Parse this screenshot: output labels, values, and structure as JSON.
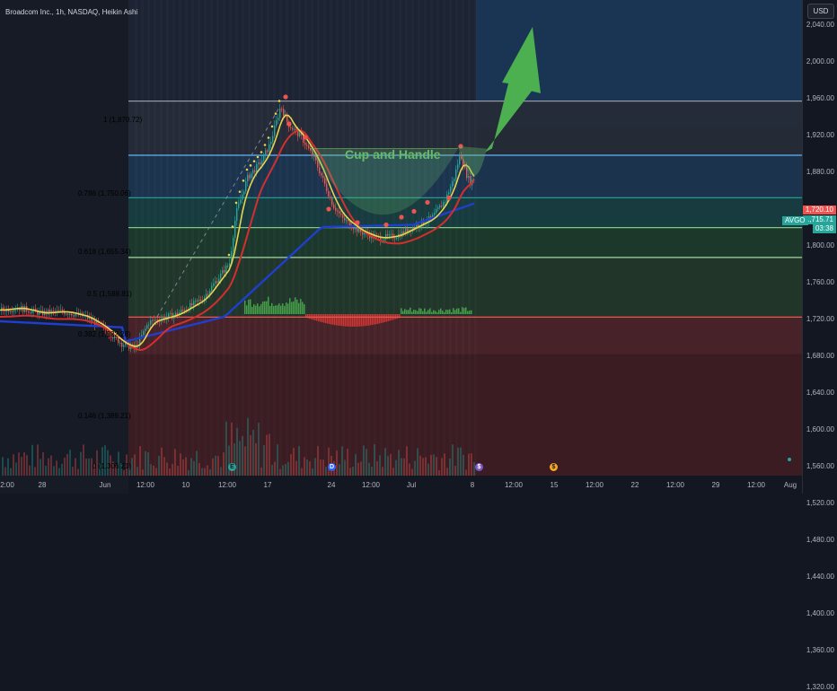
{
  "header": {
    "title": "Broadcom Inc., 1h, NASDAQ, Heikin Ashi",
    "currency": "USD"
  },
  "price_axis": {
    "ticks": [
      "2,040.00",
      "2,000.00",
      "1,960.00",
      "1,920.00",
      "1,880.00",
      "1,840.00",
      "1,800.00",
      "1,760.00",
      "1,720.00",
      "1,680.00",
      "1,640.00",
      "1,600.00",
      "1,560.00",
      "1,520.00",
      "1,480.00",
      "1,440.00",
      "1,400.00",
      "1,360.00",
      "1,320.00"
    ]
  },
  "time_axis": {
    "ticks": [
      "2:00",
      "28",
      "Jun",
      "12:00",
      "10",
      "12:00",
      "17",
      "24",
      "12:00",
      "Jul",
      "8",
      "12:00",
      "15",
      "12:00",
      "22",
      "12:00",
      "29",
      "12:00",
      "Aug"
    ]
  },
  "fib_levels": [
    {
      "label": "1 (1,870.72)",
      "color": "#9598a1"
    },
    {
      "label": "0.786 (1,750.06)",
      "color": "#64b5f6"
    },
    {
      "label": "0.618 (1,655.34)",
      "color": "#26a69a"
    },
    {
      "label": "0.5 (1,588.81)",
      "color": "#81c784"
    },
    {
      "label": "0.382 (1,522.28)",
      "color": "#a5d6a7"
    },
    {
      "label": "0.146 (1,389.21)",
      "color": "#ef5350"
    },
    {
      "label": "0 (1,306.21)",
      "color": "#b2b5be"
    }
  ],
  "price_tags": {
    "red_price": "1,720.10",
    "symbol": "AVGO",
    "last_price": "1,715.71",
    "countdown": "03:38"
  },
  "annotation": {
    "text": "Cup and Handle"
  },
  "event_markers": [
    "E",
    "D",
    "$",
    "$"
  ],
  "colors": {
    "up": "#26a69a",
    "down": "#ef5350",
    "ma_red": "#d32f2f",
    "ma_yellow": "#e8d44d",
    "ma_blue": "#1e3fcf",
    "arrow": "#4caf50"
  }
}
